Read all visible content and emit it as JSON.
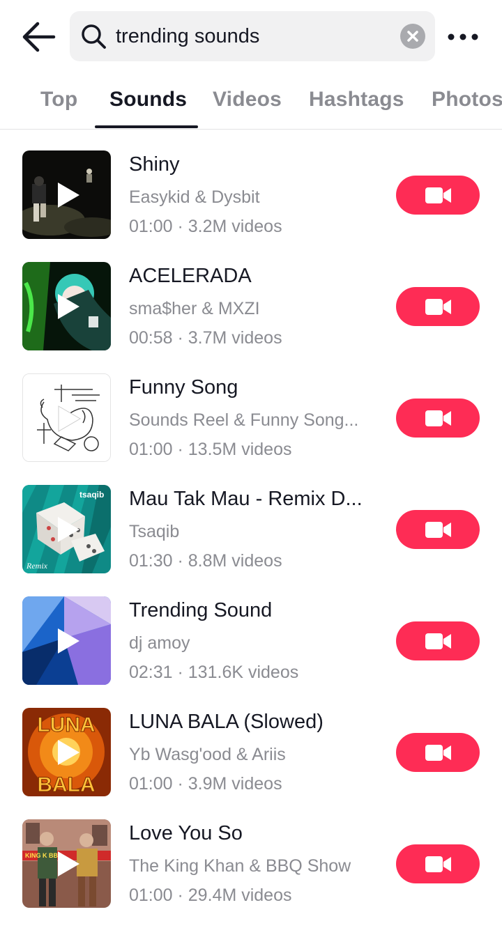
{
  "search": {
    "value": "trending sounds"
  },
  "icons": {
    "back": "arrow-left-icon",
    "search": "search-icon",
    "clear": "clear-x-icon",
    "more": "more-horizontal-icon",
    "play": "play-icon",
    "record": "video-camera-icon"
  },
  "colors": {
    "accent": "#fe2c55",
    "text_primary": "#161823",
    "text_secondary": "#8a8b91"
  },
  "tabs": [
    {
      "label": "Top",
      "active": false
    },
    {
      "label": "Sounds",
      "active": true
    },
    {
      "label": "Videos",
      "active": false
    },
    {
      "label": "Hashtags",
      "active": false
    },
    {
      "label": "Photos",
      "active": false
    }
  ],
  "sounds": [
    {
      "title": "Shiny",
      "artist": "Easykid & Dysbit",
      "duration": "01:00",
      "videos": "3.2M videos"
    },
    {
      "title": "ACELERADA",
      "artist": "sma$her & MXZI",
      "duration": "00:58",
      "videos": "3.7M videos"
    },
    {
      "title": "Funny Song",
      "artist": "Sounds Reel & Funny Song...",
      "duration": "01:00",
      "videos": "13.5M videos"
    },
    {
      "title": "Mau Tak Mau - Remix D...",
      "artist": "Tsaqib",
      "duration": "01:30",
      "videos": "8.8M videos"
    },
    {
      "title": "Trending Sound",
      "artist": "dj amoy",
      "duration": "02:31",
      "videos": "131.6K videos"
    },
    {
      "title": "LUNA BALA (Slowed)",
      "artist": "Yb Wasg'ood & Ariis",
      "duration": "01:00",
      "videos": "3.9M videos"
    },
    {
      "title": "Love You So",
      "artist": "The King Khan & BBQ Show",
      "duration": "01:00",
      "videos": "29.4M videos"
    }
  ],
  "cover_art_text": {
    "tsaqib": "tsaqib",
    "remix": "Remix",
    "luna_top": "LUNA",
    "luna_bottom": "BALA",
    "kingkhan": "KING K    BBQ"
  }
}
